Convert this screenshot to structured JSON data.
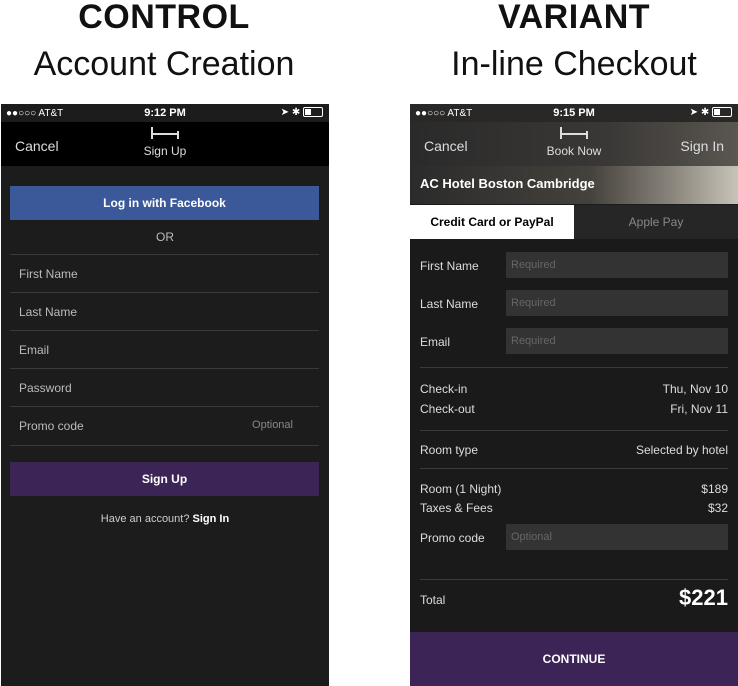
{
  "control": {
    "heading": "CONTROL",
    "subheading": "Account Creation",
    "status": {
      "carrier": "●●○○○ AT&T",
      "time": "9:12 PM"
    },
    "nav": {
      "left": "Cancel",
      "title": "Sign Up"
    },
    "facebook_button": "Log in with Facebook",
    "or_text": "OR",
    "fields": [
      {
        "label": "First Name"
      },
      {
        "label": "Last Name"
      },
      {
        "label": "Email"
      },
      {
        "label": "Password"
      },
      {
        "label": "Promo code",
        "hint": "Optional"
      }
    ],
    "signup_button": "Sign Up",
    "have_account_text": "Have an account?",
    "sign_in_link": "Sign In"
  },
  "variant": {
    "heading": "VARIANT",
    "subheading": "In-line Checkout",
    "status": {
      "carrier": "●●○○○ AT&T",
      "time": "9:15 PM"
    },
    "nav": {
      "left": "Cancel",
      "title": "Book Now",
      "right": "Sign In"
    },
    "hotel_name": "AC Hotel Boston Cambridge",
    "tabs": [
      "Credit Card or PayPal",
      "Apple Pay"
    ],
    "fields": [
      {
        "label": "First Name",
        "placeholder": "Required"
      },
      {
        "label": "Last Name",
        "placeholder": "Required"
      },
      {
        "label": "Email",
        "placeholder": "Required"
      }
    ],
    "checkin_label": "Check-in",
    "checkin_value": "Thu, Nov 10",
    "checkout_label": "Check-out",
    "checkout_value": "Fri, Nov 11",
    "room_type_label": "Room type",
    "room_type_value": "Selected by hotel",
    "room_label": "Room (1 Night)",
    "room_price": "$189",
    "taxes_label": "Taxes & Fees",
    "taxes_price": "$32",
    "promo_label": "Promo code",
    "promo_placeholder": "Optional",
    "total_label": "Total",
    "total_value": "$221",
    "continue_button": "CONTINUE"
  },
  "colors": {
    "facebook": "#3b5998",
    "accent_purple": "#3d2456",
    "background": "#1c1c1c"
  }
}
